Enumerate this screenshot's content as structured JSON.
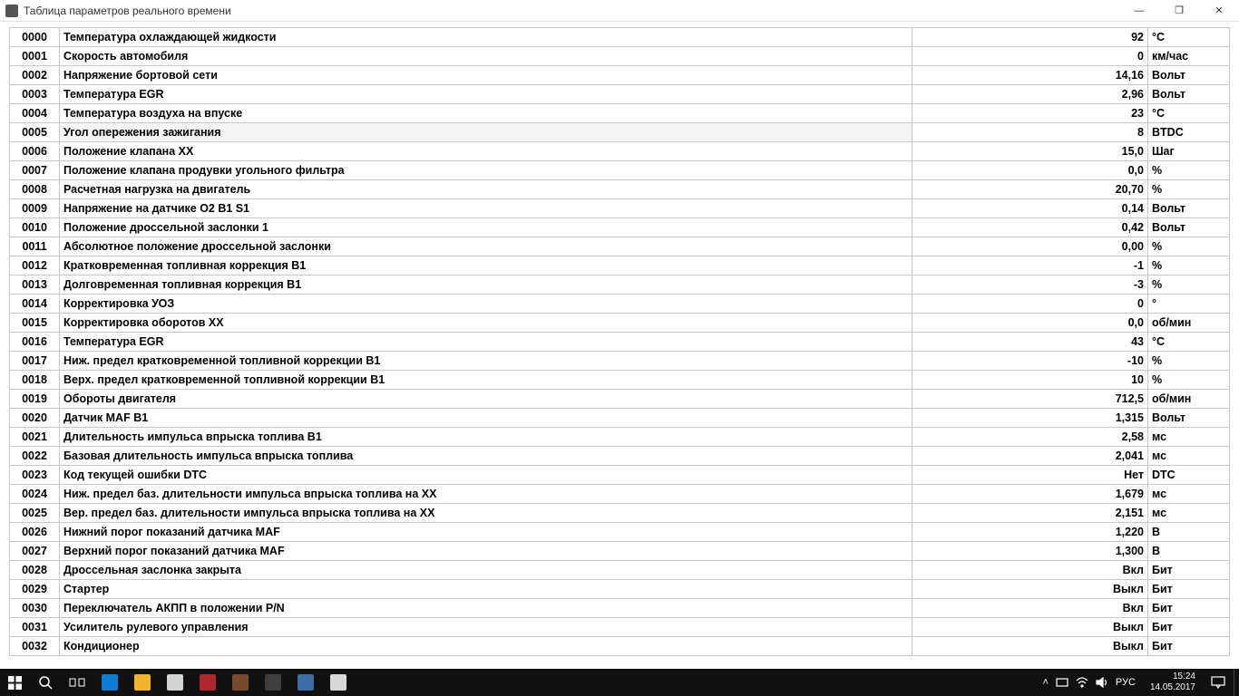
{
  "window": {
    "title": "Таблица параметров реального времени",
    "min": "—",
    "max": "❐",
    "close": "✕"
  },
  "rows": [
    {
      "id": "0000",
      "name": "Температура охлаждающей жидкости",
      "val": "92",
      "unit": "°C"
    },
    {
      "id": "0001",
      "name": "Скорость автомобиля",
      "val": "0",
      "unit": "км/час"
    },
    {
      "id": "0002",
      "name": "Напряжение бортовой сети",
      "val": "14,16",
      "unit": "Вольт"
    },
    {
      "id": "0003",
      "name": "Температура EGR",
      "val": "2,96",
      "unit": "Вольт"
    },
    {
      "id": "0004",
      "name": "Температура воздуха на впуске",
      "val": "23",
      "unit": "°C"
    },
    {
      "id": "0005",
      "name": "Угол опережения зажигания",
      "val": "8",
      "unit": "BTDC",
      "hl": true
    },
    {
      "id": "0006",
      "name": "Положение клапана XX",
      "val": "15,0",
      "unit": "Шаг"
    },
    {
      "id": "0007",
      "name": "Положение клапана продувки угольного фильтра",
      "val": "0,0",
      "unit": "%"
    },
    {
      "id": "0008",
      "name": "Расчетная нагрузка на двигатель",
      "val": "20,70",
      "unit": "%"
    },
    {
      "id": "0009",
      "name": "Напряжение на датчике O2 B1 S1",
      "val": "0,14",
      "unit": "Вольт"
    },
    {
      "id": "0010",
      "name": "Положение дроссельной заслонки 1",
      "val": "0,42",
      "unit": "Вольт"
    },
    {
      "id": "0011",
      "name": "Абсолютное положение дроссельной заслонки",
      "val": "0,00",
      "unit": "%"
    },
    {
      "id": "0012",
      "name": "Кратковременная топливная коррекция B1",
      "val": "-1",
      "unit": "%"
    },
    {
      "id": "0013",
      "name": "Долговременная топливная коррекция B1",
      "val": "-3",
      "unit": "%"
    },
    {
      "id": "0014",
      "name": "Корректировка УОЗ",
      "val": "0",
      "unit": "°"
    },
    {
      "id": "0015",
      "name": "Корректировка оборотов XX",
      "val": "0,0",
      "unit": "об/мин"
    },
    {
      "id": "0016",
      "name": "Температура EGR",
      "val": "43",
      "unit": "°C"
    },
    {
      "id": "0017",
      "name": "Ниж. предел кратковременной топливной коррекции B1",
      "val": "-10",
      "unit": "%"
    },
    {
      "id": "0018",
      "name": "Верх. предел кратковременной топливной коррекции B1",
      "val": "10",
      "unit": "%"
    },
    {
      "id": "0019",
      "name": "Обороты двигателя",
      "val": "712,5",
      "unit": "об/мин"
    },
    {
      "id": "0020",
      "name": "Датчик MAF B1",
      "val": "1,315",
      "unit": "Вольт"
    },
    {
      "id": "0021",
      "name": "Длительность импульса впрыска топлива B1",
      "val": "2,58",
      "unit": "мс"
    },
    {
      "id": "0022",
      "name": "Базовая длительность импульса впрыска топлива",
      "val": "2,041",
      "unit": "мс"
    },
    {
      "id": "0023",
      "name": "Код текущей ошибки DTC",
      "val": "Нет",
      "unit": "DTC"
    },
    {
      "id": "0024",
      "name": "Ниж. предел баз. длительности импульса впрыска топлива на XX",
      "val": "1,679",
      "unit": "мс"
    },
    {
      "id": "0025",
      "name": "Вер. предел баз. длительности импульса впрыска топлива на XX",
      "val": "2,151",
      "unit": "мс"
    },
    {
      "id": "0026",
      "name": "Нижний порог показаний датчика MAF",
      "val": "1,220",
      "unit": "В"
    },
    {
      "id": "0027",
      "name": "Верхний порог показаний датчика MAF",
      "val": "1,300",
      "unit": "В"
    },
    {
      "id": "0028",
      "name": "Дроссельная заслонка закрыта",
      "val": "Вкл",
      "unit": "Бит"
    },
    {
      "id": "0029",
      "name": "Стартер",
      "val": "Выкл",
      "unit": "Бит"
    },
    {
      "id": "0030",
      "name": "Переключатель АКПП в положении P/N",
      "val": "Вкл",
      "unit": "Бит"
    },
    {
      "id": "0031",
      "name": "Усилитель рулевого управления",
      "val": "Выкл",
      "unit": "Бит"
    },
    {
      "id": "0032",
      "name": "Кондиционер",
      "val": "Выкл",
      "unit": "Бит"
    }
  ],
  "taskbar": {
    "lang": "РУС",
    "time": "15:24",
    "date": "14.05.2017"
  }
}
